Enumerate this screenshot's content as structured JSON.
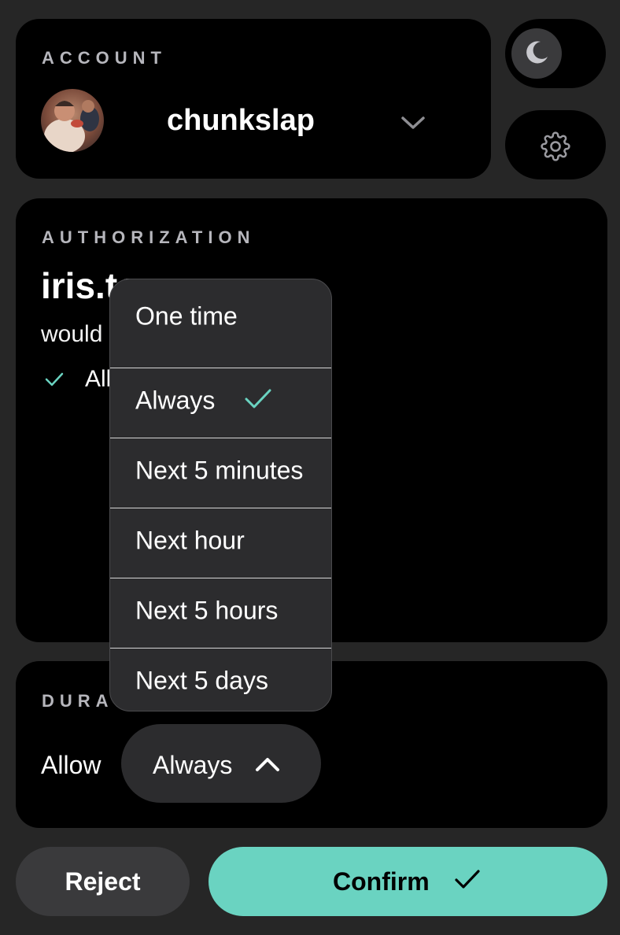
{
  "account": {
    "section_label": "ACCOUNT",
    "username": "chunkslap"
  },
  "authorization": {
    "section_label": "AUTHORIZATION",
    "site": "iris.to",
    "description": "would like to",
    "permission": "Allow"
  },
  "duration": {
    "section_label": "DURATION",
    "allow_label": "Allow",
    "selected": "Always",
    "options": [
      "One time",
      "Always",
      "Next 5 minutes",
      "Next hour",
      "Next 5 hours",
      "Next 5 days"
    ],
    "checked_option": "Always"
  },
  "actions": {
    "reject_label": "Reject",
    "confirm_label": "Confirm"
  },
  "colors": {
    "accent": "#6ad3c1",
    "background": "#262626",
    "card": "#000000",
    "popover": "#2c2c2e"
  },
  "icons": {
    "theme": "moon-icon",
    "settings": "gear-icon",
    "account_toggle": "chevron-down-icon",
    "select_toggle": "chevron-up-icon",
    "check": "checkmark-icon"
  }
}
